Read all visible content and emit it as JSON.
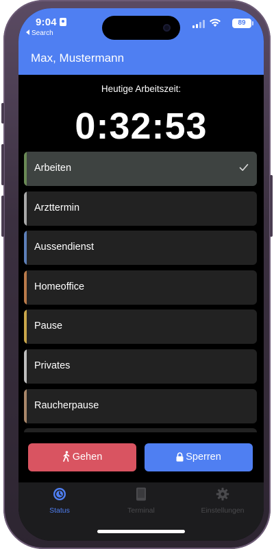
{
  "status_bar": {
    "time": "9:04",
    "back_label": "Search",
    "battery": "89"
  },
  "header": {
    "user_name": "Max, Mustermann"
  },
  "worktime": {
    "label": "Heutige Arbeitszeit:",
    "value": "0:32:53"
  },
  "status_list": {
    "items": [
      {
        "label": "Arbeiten",
        "color": "#6a8a55",
        "selected": true
      },
      {
        "label": "Arzttermin",
        "color": "#a8a8a8",
        "selected": false
      },
      {
        "label": "Aussendienst",
        "color": "#5d7fb8",
        "selected": false
      },
      {
        "label": "Homeoffice",
        "color": "#b97a4a",
        "selected": false
      },
      {
        "label": "Pause",
        "color": "#c9a64a",
        "selected": false
      },
      {
        "label": "Privates",
        "color": "#bdbdbd",
        "selected": false
      },
      {
        "label": "Raucherpause",
        "color": "#a9876a",
        "selected": false
      }
    ]
  },
  "actions": {
    "leave_label": "Gehen",
    "lock_label": "Sperren",
    "leave_color": "#d95461",
    "lock_color": "#4f7ff2"
  },
  "tabs": {
    "status": "Status",
    "terminal": "Terminal",
    "settings": "Einstellungen",
    "active_color": "#4f7ff2",
    "inactive_color": "#4a4a4d"
  }
}
